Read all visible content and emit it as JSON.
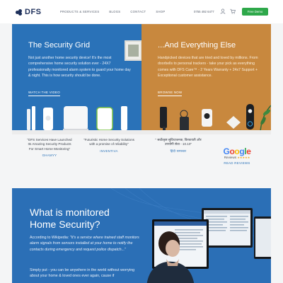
{
  "header": {
    "logo_text": "DFS",
    "nav": [
      "PRODUCTS & SERVICES",
      "BLOGS",
      "CONTACT",
      "SHOP"
    ],
    "phone": "0755 492 6477",
    "cta": "Free Demo"
  },
  "hero_left": {
    "title": "The Security Grid",
    "body": "Not just another home security device! It's the most comprehensive home security solution ever - 24X7 professionally monitored alarm system to guard your home day & night. This is how security should be done.",
    "link": "WATCH THE VIDEO"
  },
  "hero_right": {
    "title": "...And Everything Else",
    "body": "Handpicked devices that are tried and loved by millions. From doorbells to personal trackers - take your pick as everything comes with DFS Care™ - 2 Years Warranty + 24x7 Support + Exceptional customer assistance.",
    "link": "BROWSE NOW"
  },
  "testimonials": [
    {
      "quote": "\"DFS Services Have Launched Its Amazing Security Products For Smart Home Monitoring\"",
      "source": "GHAMYY"
    },
    {
      "quote": "\"Futuristic Home Security Solutions with a promise of reliability\"",
      "source": "INVENTIVA"
    },
    {
      "quote": "\" सर्वोत्कृष्ट सुविधाजनक, किफायती और उपयोगी सेवा - 10.10\"",
      "source": "हिंदी समाचार"
    }
  ],
  "google": {
    "logo": "Google",
    "sub": "Reviews",
    "stars": "★★★★★",
    "link": "READ REVIEWS"
  },
  "monitored": {
    "title": "What is monitored\nHome Security?",
    "p1_prefix": "According to Wikipedia: ",
    "p1_quote": "\"It's a service where trained staff monitors alarm signals from sensors installed at your home to notify the contacts during emergency and request police dispatch...\"",
    "p2": "Simply put - you can be anywhere in the world without worrying about your home & loved ones ever again, cause if"
  },
  "colors": {
    "brand_navy": "#1d2f5a",
    "blue": "#2a72b8",
    "tan": "#c8883e",
    "green": "#2ea84a"
  }
}
